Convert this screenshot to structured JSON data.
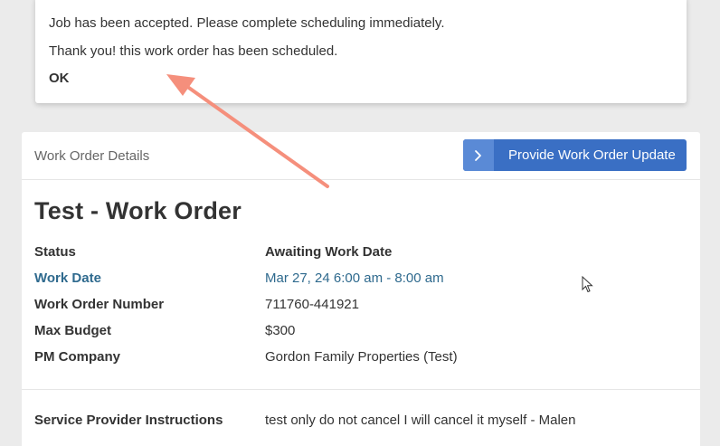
{
  "notification": {
    "message_accepted": "Job has been accepted. Please complete scheduling immediately.",
    "message_scheduled": "Thank you! this work order has been scheduled.",
    "ok_label": "OK"
  },
  "card": {
    "header_title": "Work Order Details",
    "update_button_label": "Provide Work Order Update",
    "update_button_icon": "chevron-right-icon",
    "work_order_title": "Test - Work Order",
    "fields": [
      {
        "label": "Status",
        "value": "Awaiting Work Date"
      },
      {
        "label": "Work Date",
        "value": "Mar 27, 24 6:00 am - 8:00 am"
      },
      {
        "label": "Work Order Number",
        "value": "711760-441921"
      },
      {
        "label": "Max Budget",
        "value": "$300"
      },
      {
        "label": "PM Company",
        "value": "Gordon Family Properties (Test)"
      }
    ],
    "instructions": {
      "label": "Service Provider Instructions",
      "value": "test only do not cancel I will cancel it myself - Malen"
    }
  },
  "colors": {
    "primary_button": "#3a6fc4",
    "link": "#2f6a8e",
    "annotation_arrow": "#f58f7c"
  }
}
